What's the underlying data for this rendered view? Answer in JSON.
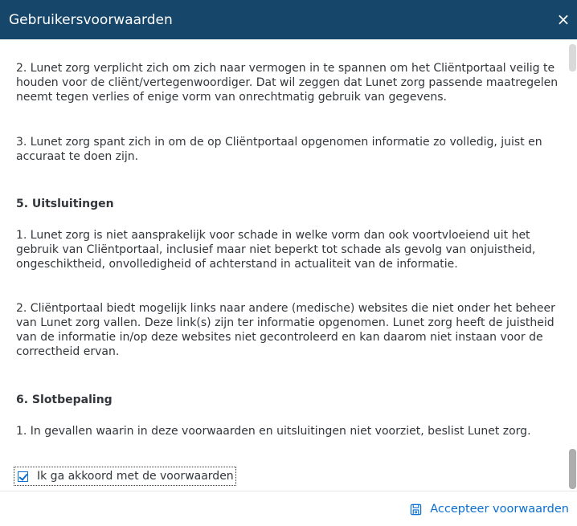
{
  "dialog": {
    "title": "Gebruikersvoorwaarden",
    "close_label": "×"
  },
  "content": {
    "paragraphs": [
      "2. Lunet zorg verplicht zich om zich naar vermogen in te spannen om het Cliëntportaal veilig te houden voor de cliënt/vertegenwoordiger. Dat wil zeggen dat Lunet zorg passende maatregelen neemt tegen verlies of enige vorm van onrechtmatig gebruik van gegevens.",
      "3. Lunet zorg spant zich in om de op Cliëntportaal opgenomen informatie zo volledig, juist en accuraat te doen zijn.",
      "5. Uitsluitingen",
      "1. Lunet zorg is niet aansprakelijk voor schade in welke vorm dan ook voortvloeiend uit het gebruik van Cliëntportaal, inclusief maar niet beperkt tot schade als gevolg van onjuistheid, ongeschiktheid, onvolledigheid of achterstand in actualiteit van de informatie.",
      "2. Cliëntportaal biedt mogelijk links naar andere (medische) websites die niet onder het beheer van Lunet zorg vallen. Deze link(s) zijn ter informatie opgenomen. Lunet zorg heeft de juistheid van de informatie in/op deze websites niet gecontroleerd en kan daarom niet instaan voor de correctheid ervan.",
      "6. Slotbepaling",
      "1. In gevallen waarin in deze voorwaarden en uitsluitingen niet voorziet, beslist Lunet zorg."
    ]
  },
  "agreement": {
    "label": "Ik ga akkoord met de voorwaarden",
    "checked": true
  },
  "footer": {
    "accept_label": "Accepteer voorwaarden",
    "accept_icon": "save-icon"
  },
  "colors": {
    "header_bg": "#16466a",
    "accent": "#0a6ed1",
    "text": "#32363a"
  }
}
